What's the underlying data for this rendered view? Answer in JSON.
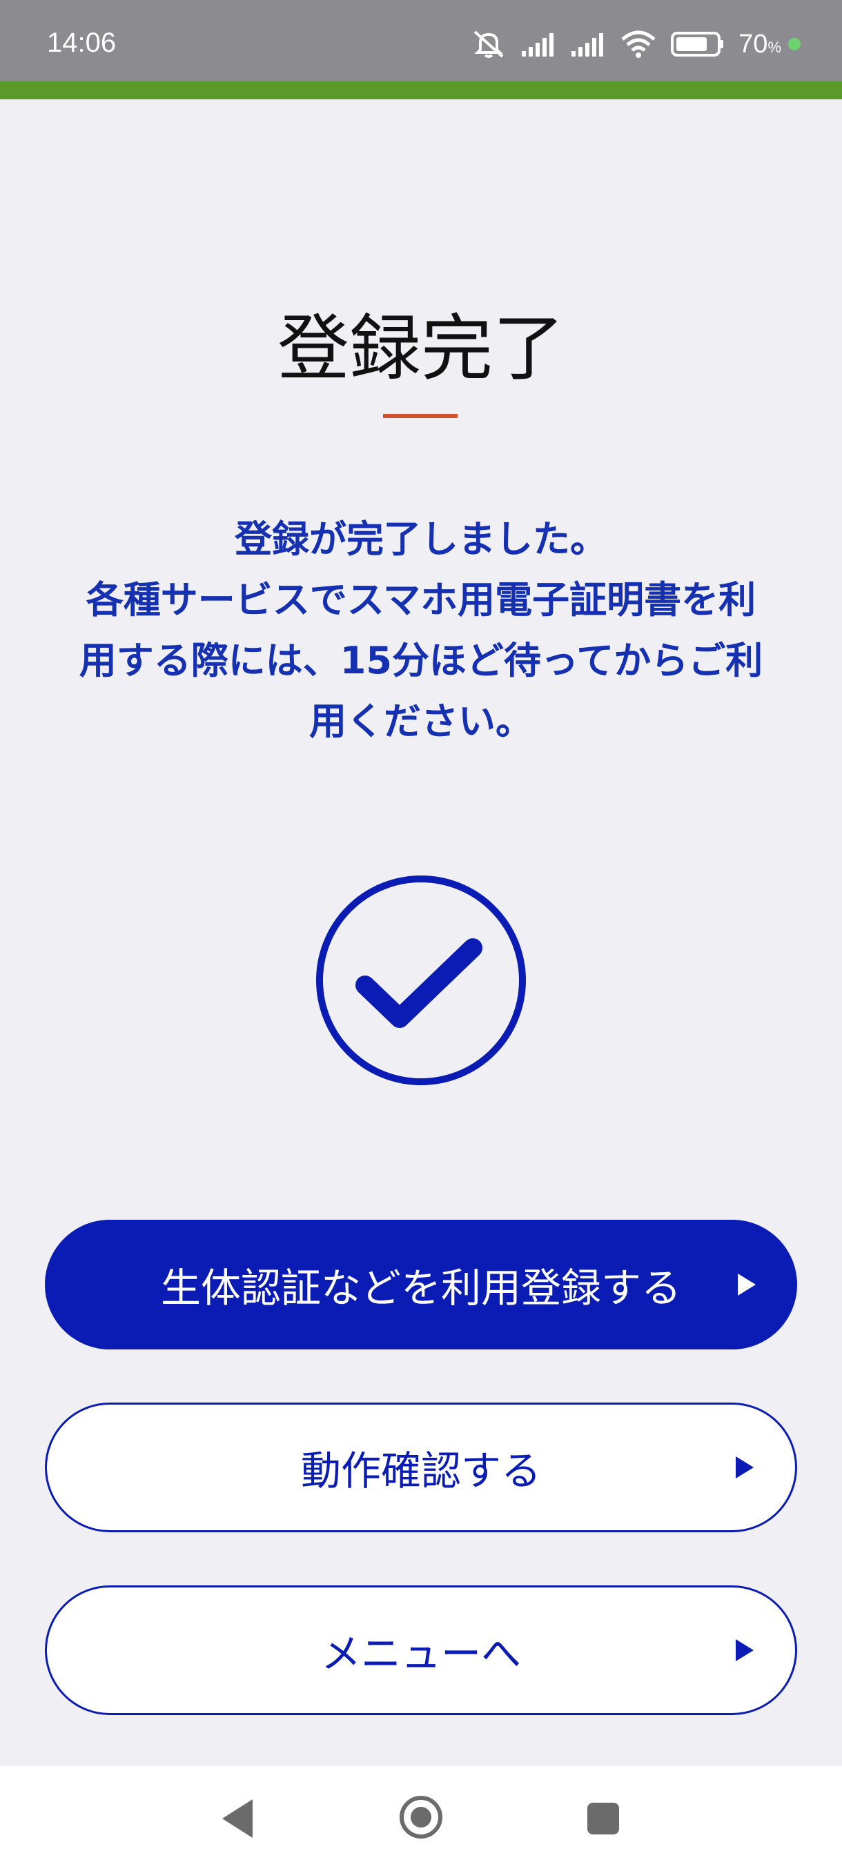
{
  "status_bar": {
    "time": "14:06",
    "battery_percent": "70",
    "battery_unit": "%",
    "icons": [
      "mute-icon",
      "signal-icon",
      "signal-icon",
      "wifi-icon",
      "battery-icon"
    ]
  },
  "page": {
    "title": "登録完了",
    "message": "登録が完了しました。\n各種サービスでスマホ用電子証明書を利用する際には、15分ほど待ってからご利用ください。"
  },
  "buttons": {
    "biometric_label": "生体認証などを利用登録する",
    "check_label": "動作確認する",
    "menu_label": "メニューへ"
  },
  "nav_bar": {
    "icons": [
      "back-icon",
      "home-icon",
      "recents-icon"
    ]
  },
  "colors": {
    "accent_bar": "#5a9a28",
    "primary": "#0a1cb4",
    "message_text": "#1530b0",
    "title_underline": "#d2502d",
    "background": "#f0f0f4"
  }
}
